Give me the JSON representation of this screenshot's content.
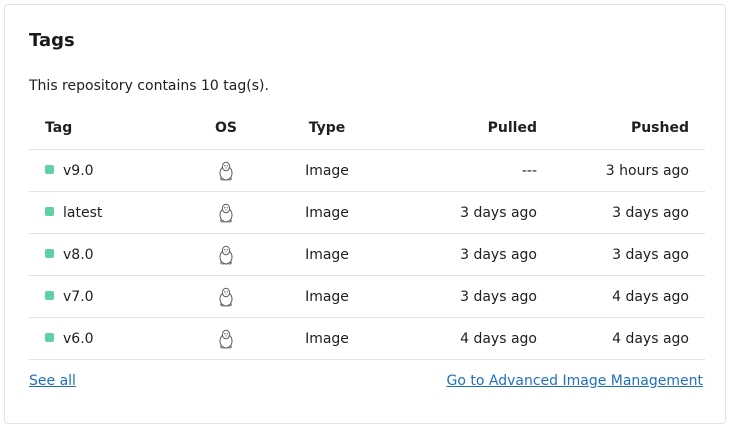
{
  "panel": {
    "title": "Tags",
    "summary": "This repository contains 10 tag(s)."
  },
  "table": {
    "headers": {
      "tag": "Tag",
      "os": "OS",
      "type": "Type",
      "pulled": "Pulled",
      "pushed": "Pushed"
    },
    "rows": [
      {
        "tag": "v9.0",
        "os_icon": "linux-penguin-icon",
        "type": "Image",
        "pulled": "---",
        "pushed": "3 hours ago"
      },
      {
        "tag": "latest",
        "os_icon": "linux-penguin-icon",
        "type": "Image",
        "pulled": "3 days ago",
        "pushed": "3 days ago"
      },
      {
        "tag": "v8.0",
        "os_icon": "linux-penguin-icon",
        "type": "Image",
        "pulled": "3 days ago",
        "pushed": "3 days ago"
      },
      {
        "tag": "v7.0",
        "os_icon": "linux-penguin-icon",
        "type": "Image",
        "pulled": "3 days ago",
        "pushed": "4 days ago"
      },
      {
        "tag": "v6.0",
        "os_icon": "linux-penguin-icon",
        "type": "Image",
        "pulled": "4 days ago",
        "pushed": "4 days ago"
      }
    ]
  },
  "footer": {
    "see_all": "See all",
    "advanced": "Go to Advanced Image Management"
  },
  "colors": {
    "tag_status": "#5fd1a5",
    "link": "#1f70c1",
    "border": "#dfe3e6"
  }
}
